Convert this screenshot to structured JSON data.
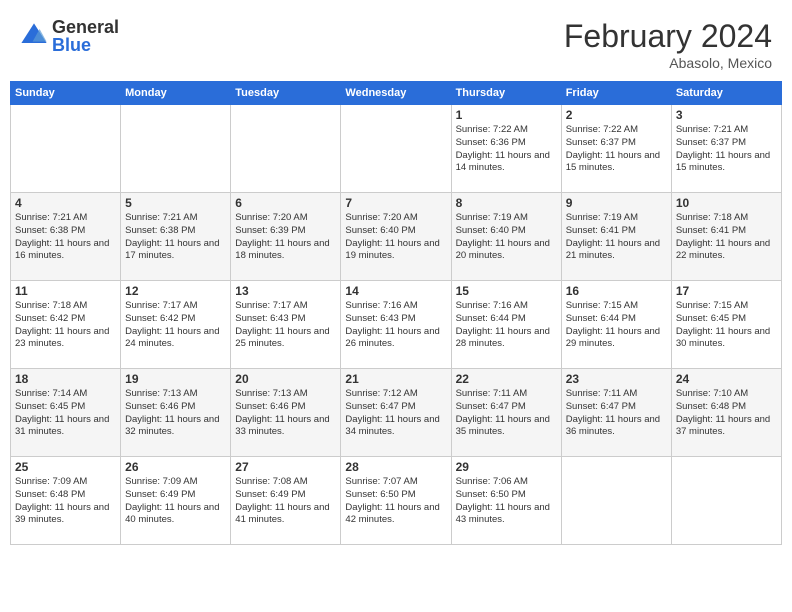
{
  "header": {
    "logo_general": "General",
    "logo_blue": "Blue",
    "month_title": "February 2024",
    "location": "Abasolo, Mexico"
  },
  "weekdays": [
    "Sunday",
    "Monday",
    "Tuesday",
    "Wednesday",
    "Thursday",
    "Friday",
    "Saturday"
  ],
  "weeks": [
    [
      {
        "day": "",
        "info": ""
      },
      {
        "day": "",
        "info": ""
      },
      {
        "day": "",
        "info": ""
      },
      {
        "day": "",
        "info": ""
      },
      {
        "day": "1",
        "info": "Sunrise: 7:22 AM\nSunset: 6:36 PM\nDaylight: 11 hours and 14 minutes."
      },
      {
        "day": "2",
        "info": "Sunrise: 7:22 AM\nSunset: 6:37 PM\nDaylight: 11 hours and 15 minutes."
      },
      {
        "day": "3",
        "info": "Sunrise: 7:21 AM\nSunset: 6:37 PM\nDaylight: 11 hours and 15 minutes."
      }
    ],
    [
      {
        "day": "4",
        "info": "Sunrise: 7:21 AM\nSunset: 6:38 PM\nDaylight: 11 hours and 16 minutes."
      },
      {
        "day": "5",
        "info": "Sunrise: 7:21 AM\nSunset: 6:38 PM\nDaylight: 11 hours and 17 minutes."
      },
      {
        "day": "6",
        "info": "Sunrise: 7:20 AM\nSunset: 6:39 PM\nDaylight: 11 hours and 18 minutes."
      },
      {
        "day": "7",
        "info": "Sunrise: 7:20 AM\nSunset: 6:40 PM\nDaylight: 11 hours and 19 minutes."
      },
      {
        "day": "8",
        "info": "Sunrise: 7:19 AM\nSunset: 6:40 PM\nDaylight: 11 hours and 20 minutes."
      },
      {
        "day": "9",
        "info": "Sunrise: 7:19 AM\nSunset: 6:41 PM\nDaylight: 11 hours and 21 minutes."
      },
      {
        "day": "10",
        "info": "Sunrise: 7:18 AM\nSunset: 6:41 PM\nDaylight: 11 hours and 22 minutes."
      }
    ],
    [
      {
        "day": "11",
        "info": "Sunrise: 7:18 AM\nSunset: 6:42 PM\nDaylight: 11 hours and 23 minutes."
      },
      {
        "day": "12",
        "info": "Sunrise: 7:17 AM\nSunset: 6:42 PM\nDaylight: 11 hours and 24 minutes."
      },
      {
        "day": "13",
        "info": "Sunrise: 7:17 AM\nSunset: 6:43 PM\nDaylight: 11 hours and 25 minutes."
      },
      {
        "day": "14",
        "info": "Sunrise: 7:16 AM\nSunset: 6:43 PM\nDaylight: 11 hours and 26 minutes."
      },
      {
        "day": "15",
        "info": "Sunrise: 7:16 AM\nSunset: 6:44 PM\nDaylight: 11 hours and 28 minutes."
      },
      {
        "day": "16",
        "info": "Sunrise: 7:15 AM\nSunset: 6:44 PM\nDaylight: 11 hours and 29 minutes."
      },
      {
        "day": "17",
        "info": "Sunrise: 7:15 AM\nSunset: 6:45 PM\nDaylight: 11 hours and 30 minutes."
      }
    ],
    [
      {
        "day": "18",
        "info": "Sunrise: 7:14 AM\nSunset: 6:45 PM\nDaylight: 11 hours and 31 minutes."
      },
      {
        "day": "19",
        "info": "Sunrise: 7:13 AM\nSunset: 6:46 PM\nDaylight: 11 hours and 32 minutes."
      },
      {
        "day": "20",
        "info": "Sunrise: 7:13 AM\nSunset: 6:46 PM\nDaylight: 11 hours and 33 minutes."
      },
      {
        "day": "21",
        "info": "Sunrise: 7:12 AM\nSunset: 6:47 PM\nDaylight: 11 hours and 34 minutes."
      },
      {
        "day": "22",
        "info": "Sunrise: 7:11 AM\nSunset: 6:47 PM\nDaylight: 11 hours and 35 minutes."
      },
      {
        "day": "23",
        "info": "Sunrise: 7:11 AM\nSunset: 6:47 PM\nDaylight: 11 hours and 36 minutes."
      },
      {
        "day": "24",
        "info": "Sunrise: 7:10 AM\nSunset: 6:48 PM\nDaylight: 11 hours and 37 minutes."
      }
    ],
    [
      {
        "day": "25",
        "info": "Sunrise: 7:09 AM\nSunset: 6:48 PM\nDaylight: 11 hours and 39 minutes."
      },
      {
        "day": "26",
        "info": "Sunrise: 7:09 AM\nSunset: 6:49 PM\nDaylight: 11 hours and 40 minutes."
      },
      {
        "day": "27",
        "info": "Sunrise: 7:08 AM\nSunset: 6:49 PM\nDaylight: 11 hours and 41 minutes."
      },
      {
        "day": "28",
        "info": "Sunrise: 7:07 AM\nSunset: 6:50 PM\nDaylight: 11 hours and 42 minutes."
      },
      {
        "day": "29",
        "info": "Sunrise: 7:06 AM\nSunset: 6:50 PM\nDaylight: 11 hours and 43 minutes."
      },
      {
        "day": "",
        "info": ""
      },
      {
        "day": "",
        "info": ""
      }
    ]
  ]
}
